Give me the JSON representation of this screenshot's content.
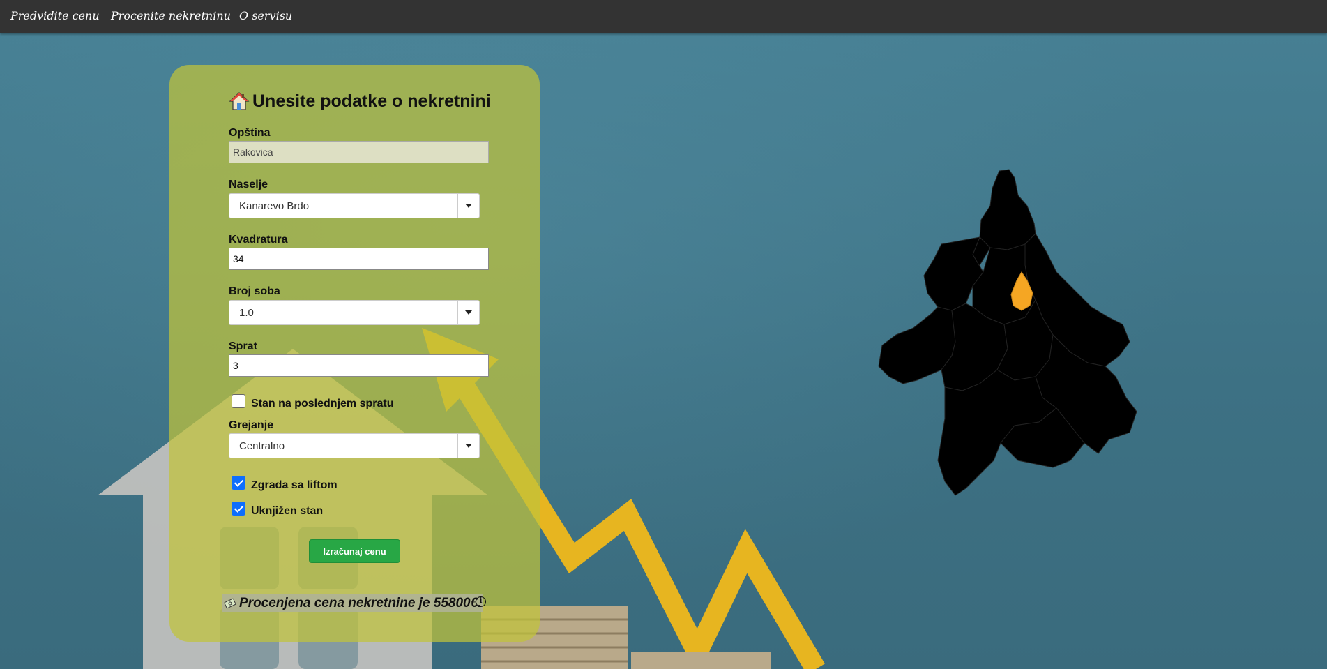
{
  "nav": {
    "items": [
      "Predvidite cenu",
      "Procenite nekretninu",
      "O servisu"
    ]
  },
  "form": {
    "title": "Unesite podatke o nekretnini",
    "opstina": {
      "label": "Opština",
      "value": "Rakovica"
    },
    "naselje": {
      "label": "Naselje",
      "value": "Kanarevo Brdo"
    },
    "kvadratura": {
      "label": "Kvadratura",
      "value": "34"
    },
    "broj_soba": {
      "label": "Broj soba",
      "value": "1.0"
    },
    "sprat": {
      "label": "Sprat",
      "value": "3"
    },
    "poslednji_sprat": {
      "label": "Stan na poslednjem spratu",
      "checked": false
    },
    "grejanje": {
      "label": "Grejanje",
      "value": "Centralno"
    },
    "lift": {
      "label": "Zgrada sa liftom",
      "checked": true
    },
    "uknjizen": {
      "label": "Uknjižen stan",
      "checked": true
    },
    "submit_label": "Izračunaj cenu"
  },
  "result": {
    "text": "Procenjena cena nekretnine je 55800€.",
    "info_icon": "i"
  },
  "map": {
    "highlighted_municipality": "Rakovica",
    "base_color": "#000000",
    "highlight_color": "#f5a623"
  },
  "colors": {
    "navbar": "#333333",
    "card": "#c0c43a",
    "button": "#28a745",
    "checkbox": "#0d6efd"
  }
}
